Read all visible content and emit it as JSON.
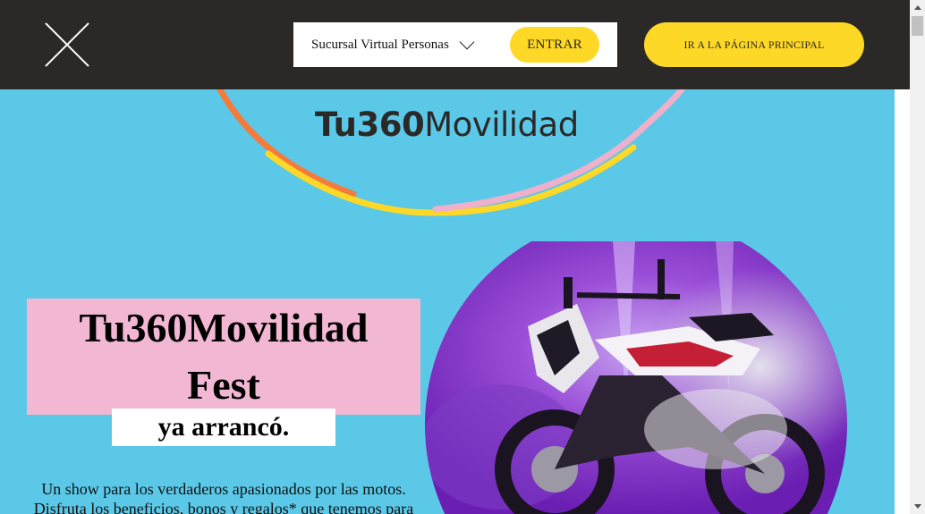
{
  "topbar": {
    "branch_label": "Sucursal Virtual Personas",
    "enter_label": "ENTRAR",
    "home_label": "IR A LA PÁGINA PRINCIPAL"
  },
  "logo": {
    "bold": "Tu360",
    "regular": "Movilidad"
  },
  "hero": {
    "title_line1": "Tu360Movilidad",
    "title_line2": "Fest",
    "subtitle": "ya arrancó.",
    "description_line1": "Un show para los verdaderos apasionados por las motos.",
    "description_line2": "Disfruta los beneficios, bonos y regalos* que tenemos para"
  },
  "colors": {
    "topbar": "#2b2927",
    "accent_yellow": "#fdd826",
    "background": "#5bc8e8",
    "title_bg": "#f2b7d2",
    "arc_orange": "#f47b3b",
    "arc_pink": "#eeb0cb",
    "arc_yellow": "#fdd826"
  },
  "icons": {
    "close": "close-icon",
    "chevron": "chevron-down-icon"
  }
}
